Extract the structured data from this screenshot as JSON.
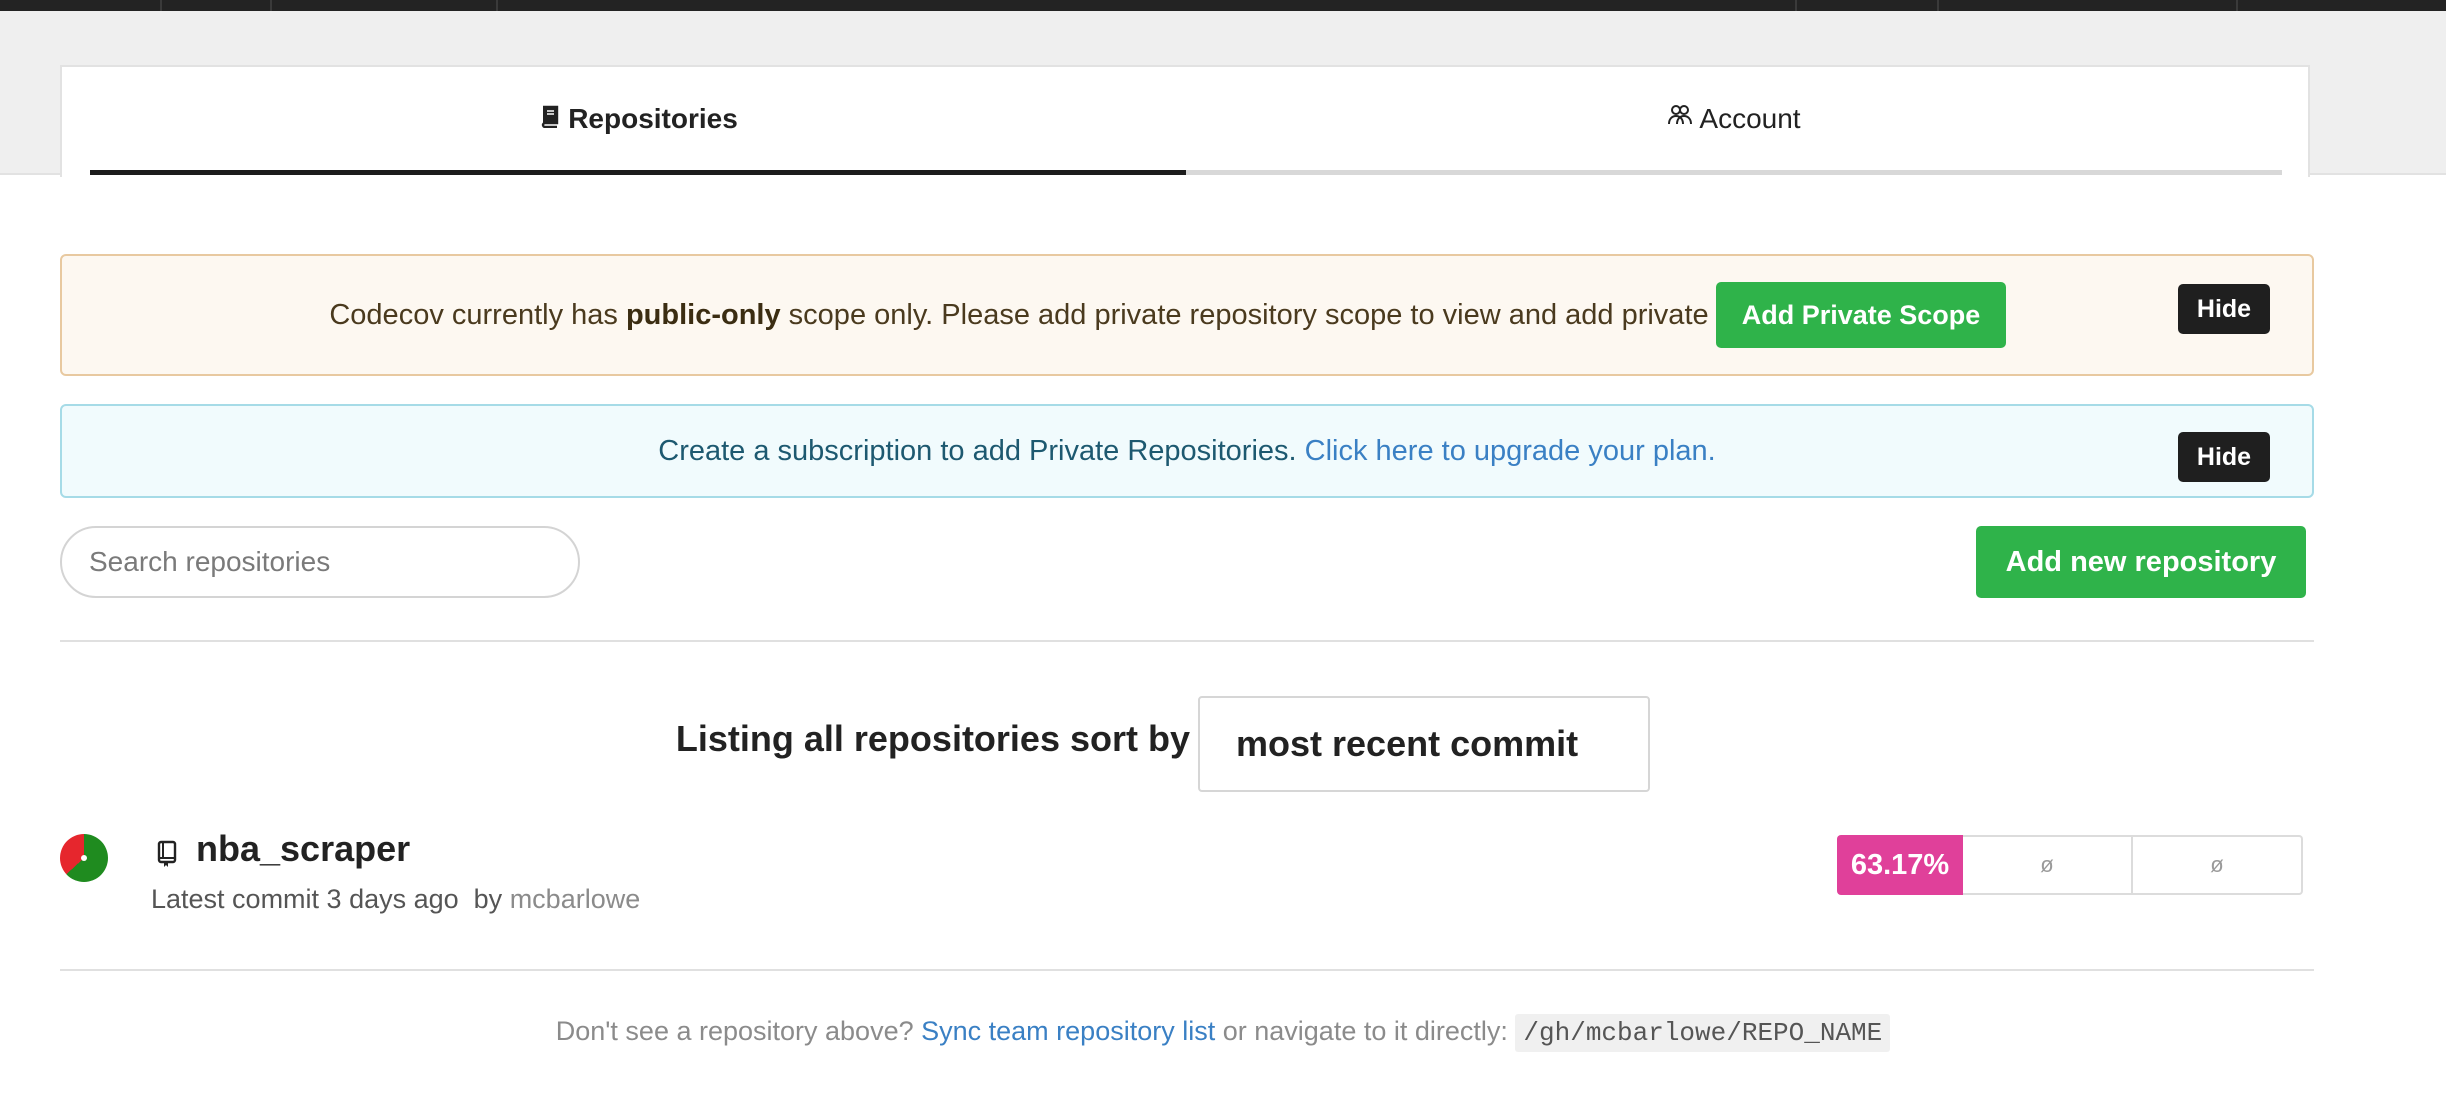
{
  "tabs": [
    {
      "label": "Repositories",
      "icon": "book-icon",
      "active": true
    },
    {
      "label": "Account",
      "icon": "users-icon",
      "active": false
    }
  ],
  "alerts": {
    "scope": {
      "text_before": "Codecov currently has ",
      "text_bold": "public-only",
      "text_after": " scope only. Please add private repository scope to view and add private repositories.",
      "button_label": "Add Private Scope",
      "hide_label": "Hide"
    },
    "subscription": {
      "text": "Create a subscription to add Private Repositories.",
      "link_text": "Click here to upgrade your plan.",
      "hide_label": "Hide"
    }
  },
  "search": {
    "placeholder": "Search repositories",
    "value": ""
  },
  "add_repo_label": "Add new repository",
  "sort": {
    "label": "Listing all repositories sort by",
    "selected": "most recent commit"
  },
  "repos": [
    {
      "name": "nba_scraper",
      "meta_prefix": "Latest commit 3 days ago  by",
      "author": "mcbarlowe",
      "coverage": "63.17%",
      "coverage_fraction": 0.6317,
      "col2": "ø",
      "col3": "ø"
    }
  ],
  "footer": {
    "prefix": "Don't see a repository above?",
    "link": "Sync team repository list",
    "middle": "or navigate to it directly:",
    "path": "/gh/mcbarlowe/REPO_NAME"
  },
  "colors": {
    "accent_green": "#2fb34a",
    "coverage_badge": "#e0409a",
    "link": "#3a80c4",
    "dark": "#1f1f1f"
  }
}
